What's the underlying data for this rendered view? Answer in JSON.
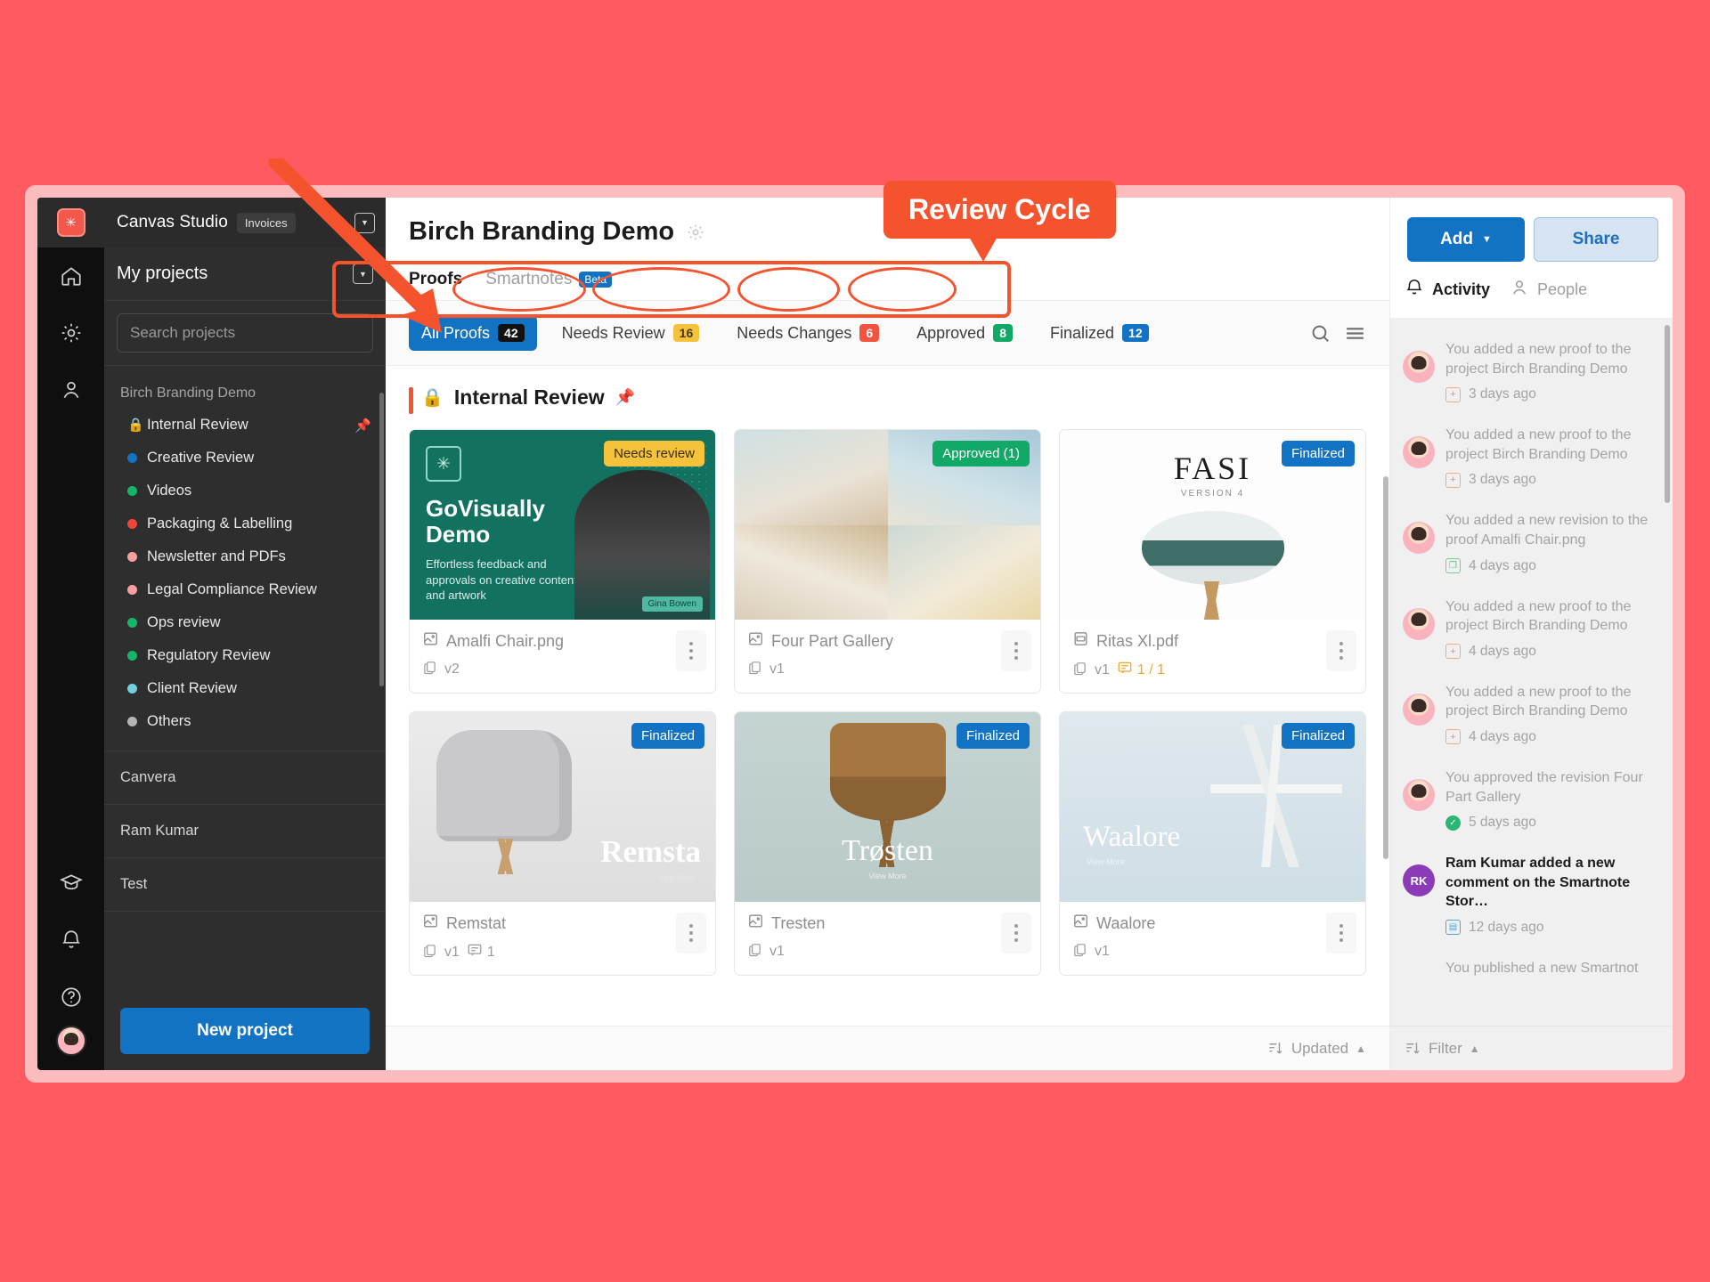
{
  "sidebar": {
    "brand_name": "Canvas Studio",
    "invoices_chip": "Invoices",
    "my_projects_label": "My projects",
    "search_placeholder": "Search projects",
    "group_title": "Birch Branding Demo",
    "projects": [
      {
        "label": "Internal Review",
        "color": "#f4532e",
        "icon": "lock-icon",
        "pinned": true
      },
      {
        "label": "Creative Review",
        "color": "#1272c4",
        "icon": "dot-icon",
        "pinned": false
      },
      {
        "label": "Videos",
        "color": "#12b76a",
        "icon": "dot-icon",
        "pinned": false
      },
      {
        "label": "Packaging & Labelling",
        "color": "#f04438",
        "icon": "dot-icon",
        "pinned": false
      },
      {
        "label": "Newsletter and PDFs",
        "color": "#f8a0a0",
        "icon": "dot-icon",
        "pinned": false
      },
      {
        "label": "Legal Compliance Review",
        "color": "#f8a0a0",
        "icon": "dot-icon",
        "pinned": false
      },
      {
        "label": "Ops review",
        "color": "#12b76a",
        "icon": "dot-icon",
        "pinned": false
      },
      {
        "label": "Regulatory Review",
        "color": "#12b76a",
        "icon": "dot-icon",
        "pinned": false
      },
      {
        "label": "Client Review",
        "color": "#72d0dd",
        "icon": "dot-icon",
        "pinned": false
      },
      {
        "label": "Others",
        "color": "#b4b4b4",
        "icon": "dot-icon",
        "pinned": false
      }
    ],
    "other_groups": [
      "Canvera",
      "Ram Kumar",
      "Test"
    ],
    "new_project_label": "New project",
    "rail_icons": [
      "home-icon",
      "gear-icon",
      "person-icon",
      "graduation-cap-icon",
      "bell-icon",
      "help-icon"
    ]
  },
  "header": {
    "project_title": "Birch Branding Demo",
    "settings_icon": "gear-icon",
    "tabs": [
      {
        "label": "Proofs",
        "active": true,
        "chip": ""
      },
      {
        "label": "Smartnotes",
        "active": false,
        "chip": "Beta"
      }
    ],
    "add_label": "Add",
    "share_label": "Share"
  },
  "filters": {
    "pills": [
      {
        "label": "All Proofs",
        "count": "42",
        "count_color": "#111111",
        "active": true
      },
      {
        "label": "Needs Review",
        "count": "16",
        "count_color": "#f5c33b",
        "active": false
      },
      {
        "label": "Needs Changes",
        "count": "6",
        "count_color": "#f4533f",
        "active": false
      },
      {
        "label": "Approved",
        "count": "8",
        "count_color": "#12a868",
        "active": false
      },
      {
        "label": "Finalized",
        "count": "12",
        "count_color": "#1272c4",
        "active": false
      }
    ],
    "search_icon": "search-icon",
    "list_view_icon": "list-view-icon"
  },
  "section": {
    "lock_icon": "lock-icon",
    "title": "Internal Review",
    "pin_icon": "pushpin-icon"
  },
  "cards": [
    {
      "name": "Amalfi Chair.png",
      "file_icon": "image-file-icon",
      "version": "v2",
      "comments": "",
      "comments_highlight": false,
      "badge": "Needs review",
      "badge_color": "#f5c33b",
      "badge_text_color": "#3b2c00",
      "thumb": "govisually-demo",
      "thumb_title": "GoVisually Demo",
      "thumb_body": "Effortless feedback and approvals on creative content and artwork",
      "thumb_chip": "Gina Bowen"
    },
    {
      "name": "Four Part Gallery",
      "file_icon": "image-file-icon",
      "version": "v1",
      "comments": "",
      "comments_highlight": false,
      "badge": "Approved (1)",
      "badge_color": "#12a868",
      "badge_text_color": "#ffffff",
      "thumb": "four-part-gallery"
    },
    {
      "name": "Ritas Xl.pdf",
      "file_icon": "pdf-file-icon",
      "version": "v1",
      "comments": "1 / 1",
      "comments_highlight": true,
      "badge": "Finalized",
      "badge_color": "#1272c4",
      "badge_text_color": "#ffffff",
      "thumb": "fasi",
      "thumb_title": "FASI",
      "thumb_sub": "VERSION 4"
    },
    {
      "name": "Remstat",
      "file_icon": "image-file-icon",
      "version": "v1",
      "comments": "1",
      "comments_highlight": false,
      "badge": "Finalized",
      "badge_color": "#1272c4",
      "badge_text_color": "#ffffff",
      "thumb": "remsta",
      "thumb_title": "Remsta",
      "thumb_sub": "View More"
    },
    {
      "name": "Tresten",
      "file_icon": "image-file-icon",
      "version": "v1",
      "comments": "",
      "comments_highlight": false,
      "badge": "Finalized",
      "badge_color": "#1272c4",
      "badge_text_color": "#ffffff",
      "thumb": "trosten",
      "thumb_title": "Trøsten",
      "thumb_sub": "View More"
    },
    {
      "name": "Waalore",
      "file_icon": "image-file-icon",
      "version": "v1",
      "comments": "",
      "comments_highlight": false,
      "badge": "Finalized",
      "badge_color": "#1272c4",
      "badge_text_color": "#ffffff",
      "thumb": "waalore",
      "thumb_title": "Waalore",
      "thumb_sub": "View More"
    }
  ],
  "sort_bar": {
    "label": "Updated",
    "icon": "sort-icon",
    "caret": "caret-up-icon"
  },
  "right_panel": {
    "tabs": [
      {
        "label": "Activity",
        "icon": "bell-icon",
        "active": true
      },
      {
        "label": "People",
        "icon": "person-icon",
        "active": false
      }
    ],
    "activity": [
      {
        "text": "You added a new proof to the project Birch Branding Demo",
        "time": "3 days ago",
        "type": "add",
        "avatar": "photo",
        "bold": false
      },
      {
        "text": "You added a new proof to the project Birch Branding Demo",
        "time": "3 days ago",
        "type": "add",
        "avatar": "photo",
        "bold": false
      },
      {
        "text": "You added a new revision to the proof Amalfi Chair.png",
        "time": "4 days ago",
        "type": "rev",
        "avatar": "photo",
        "bold": false
      },
      {
        "text": "You added a new proof to the project Birch Branding Demo",
        "time": "4 days ago",
        "type": "add",
        "avatar": "photo",
        "bold": false
      },
      {
        "text": "You added a new proof to the project Birch Branding Demo",
        "time": "4 days ago",
        "type": "add",
        "avatar": "photo",
        "bold": false
      },
      {
        "text": "You approved the revision Four Part Gallery",
        "time": "5 days ago",
        "type": "apr",
        "avatar": "photo",
        "bold": false
      },
      {
        "text": "Ram Kumar added a new comment on the Smartnote Stor…",
        "time": "12 days ago",
        "type": "cmt",
        "avatar": "RK",
        "bold": true
      },
      {
        "text": "You published a new Smartnot",
        "time": "",
        "type": "",
        "avatar": "none",
        "bold": false
      }
    ],
    "filter_label": "Filter"
  },
  "annotations": {
    "callout_text": "Review Cycle",
    "accent_color": "#f4532e"
  }
}
